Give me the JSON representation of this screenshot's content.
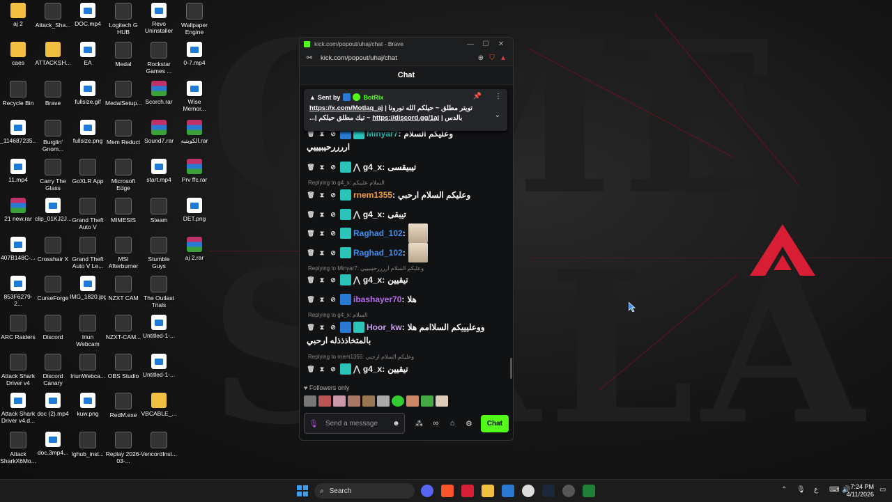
{
  "desktop_icons": [
    {
      "label": "aj 2",
      "kind": "folder"
    },
    {
      "label": "Attack_Sha...",
      "kind": "app"
    },
    {
      "label": "DOC.mp4",
      "kind": "file"
    },
    {
      "label": "Logitech G HUB",
      "kind": "app"
    },
    {
      "label": "Revo Uninstaller",
      "kind": "file"
    },
    {
      "label": "Wallpaper Engine",
      "kind": "app"
    },
    {
      "label": "caes",
      "kind": "folder"
    },
    {
      "label": "ATTACKSH...",
      "kind": "folder"
    },
    {
      "label": "EA",
      "kind": "file"
    },
    {
      "label": "Medal",
      "kind": "app"
    },
    {
      "label": "Rockstar Games ...",
      "kind": "app"
    },
    {
      "label": "0-7.mp4",
      "kind": "file"
    },
    {
      "label": "Recycle Bin",
      "kind": "app"
    },
    {
      "label": "Brave",
      "kind": "app"
    },
    {
      "label": "fullsize.gif",
      "kind": "file"
    },
    {
      "label": "MedalSetup...",
      "kind": "app"
    },
    {
      "label": "Scorch.rar",
      "kind": "rar"
    },
    {
      "label": "Wise Memor...",
      "kind": "file"
    },
    {
      "label": "_114687235...",
      "kind": "file"
    },
    {
      "label": "Burglin' Gnom...",
      "kind": "app"
    },
    {
      "label": "fullsize.png",
      "kind": "file"
    },
    {
      "label": "Mem Reduct",
      "kind": "app"
    },
    {
      "label": "Sound7.rar",
      "kind": "rar"
    },
    {
      "label": "الكويتيه.rar",
      "kind": "rar"
    },
    {
      "label": "11.mp4",
      "kind": "file"
    },
    {
      "label": "Carry The Glass",
      "kind": "app"
    },
    {
      "label": "GoXLR App",
      "kind": "app"
    },
    {
      "label": "Microsoft Edge",
      "kind": "app"
    },
    {
      "label": "start.mp4",
      "kind": "file"
    },
    {
      "label": "Prv ffc.rar",
      "kind": "rar"
    },
    {
      "label": "21 new.rar",
      "kind": "rar"
    },
    {
      "label": "clip_01KJ2J...",
      "kind": "file"
    },
    {
      "label": "Grand Theft Auto V",
      "kind": "app"
    },
    {
      "label": "MIMESIS",
      "kind": "app"
    },
    {
      "label": "Steam",
      "kind": "app"
    },
    {
      "label": "DET.png",
      "kind": "file"
    },
    {
      "label": "407B148C-...",
      "kind": "file"
    },
    {
      "label": "Crosshair X",
      "kind": "app"
    },
    {
      "label": "Grand Theft Auto V Le...",
      "kind": "app"
    },
    {
      "label": "MSI Afterburner",
      "kind": "app"
    },
    {
      "label": "Stumble Guys",
      "kind": "app"
    },
    {
      "label": "aj 2.rar",
      "kind": "rar"
    },
    {
      "label": "853F6279-2...",
      "kind": "file"
    },
    {
      "label": "CurseForge",
      "kind": "app"
    },
    {
      "label": "IMG_1820.jpg",
      "kind": "file"
    },
    {
      "label": "NZXT CAM",
      "kind": "app"
    },
    {
      "label": "The Outlast Trials",
      "kind": "app"
    },
    {
      "label": "",
      "kind": "none"
    },
    {
      "label": "ARC Raiders",
      "kind": "app"
    },
    {
      "label": "Discord",
      "kind": "app"
    },
    {
      "label": "Iriun Webcam",
      "kind": "app"
    },
    {
      "label": "NZXT-CAM...",
      "kind": "app"
    },
    {
      "label": "Untitled-1-...",
      "kind": "file"
    },
    {
      "label": "",
      "kind": "none"
    },
    {
      "label": "Attack Shark Driver v4",
      "kind": "app"
    },
    {
      "label": "Discord Canary",
      "kind": "app"
    },
    {
      "label": "IriunWebca...",
      "kind": "app"
    },
    {
      "label": "OBS Studio",
      "kind": "app"
    },
    {
      "label": "Untitled-1-...",
      "kind": "file"
    },
    {
      "label": "",
      "kind": "none"
    },
    {
      "label": "Attack Shark Driver v4.d...",
      "kind": "file"
    },
    {
      "label": "doc (2).mp4",
      "kind": "file"
    },
    {
      "label": "kuw.png",
      "kind": "file"
    },
    {
      "label": "RedM.exe",
      "kind": "app"
    },
    {
      "label": "VBCABLE_...",
      "kind": "folder"
    },
    {
      "label": "",
      "kind": "none"
    },
    {
      "label": "Attack SharkX6Mo...",
      "kind": "app"
    },
    {
      "label": "doc.3mp4...",
      "kind": "file"
    },
    {
      "label": "lghub_inst...",
      "kind": "app"
    },
    {
      "label": "Replay 2026-03-...",
      "kind": "app"
    },
    {
      "label": "VencordInst...",
      "kind": "app"
    },
    {
      "label": "",
      "kind": "none"
    }
  ],
  "browser": {
    "title": "kick.com/popout/uhaj/chat - Brave",
    "url": "kick.com/popout/uhaj/chat",
    "accent": "#53fc18"
  },
  "chat": {
    "header": "Chat",
    "pinned": {
      "sent_by": "Sent by",
      "author": "BotRix",
      "line1_link": "https://x.com/Motlaq_aj",
      "line1_text": " | تويتر مطلق ~ حيلكم الله تورونا",
      "line2_prefix": "...| ",
      "line2_text": "تيك مطلق حيلكم ~ ",
      "line2_link": "https://discord.gg/1aj",
      "line2_suffix": " | بالدس"
    },
    "messages": [
      {
        "user": "Minyar7",
        "color": "#2bc4b8",
        "text": "وعليكم السلام",
        "cont": "اررررحيبيييي"
      },
      {
        "user": "g4_x",
        "color": "#ffffff",
        "text": "تيبيقسى"
      },
      {
        "reply": "Replying to g4_x: السلام عليبكم"
      },
      {
        "user": "rnem1355",
        "color": "#f39c34",
        "text": "وعليكم السلام ارحبي"
      },
      {
        "user": "g4_x",
        "color": "#ffffff",
        "text": "تيبقى"
      },
      {
        "user": "Raghad_102",
        "color": "#3b8ff0",
        "text": ""
      },
      {
        "user": "Raghad_102",
        "color": "#3b8ff0",
        "text": ""
      },
      {
        "reply": "Replying to Minyar7: وعليكم السلام اررررحيبيييي"
      },
      {
        "user": "g4_x",
        "color": "#ffffff",
        "text": "تيقيين"
      },
      {
        "user": "ibashayer70",
        "color": "#b56cf0",
        "text": "هلا"
      },
      {
        "reply": "Replying to g4_x: السلام"
      },
      {
        "user": "Hoor_kw",
        "color": "#c9a0f0",
        "text": "ووعليييكم السلاامم هلا",
        "cont": "بالمتخاذذذله ارحبي"
      },
      {
        "reply": "Replying to rnem1355: وعليكم السلام ارحبي"
      },
      {
        "user": "g4_x",
        "color": "#ffffff",
        "text": "تيقيين"
      }
    ],
    "followers_only": "Followers only",
    "input_placeholder": "Send a message",
    "send_label": "Chat"
  },
  "taskbar": {
    "search_label": "Search",
    "time": "7:24 PM",
    "date": "4/11/2026",
    "lang": "ع"
  }
}
